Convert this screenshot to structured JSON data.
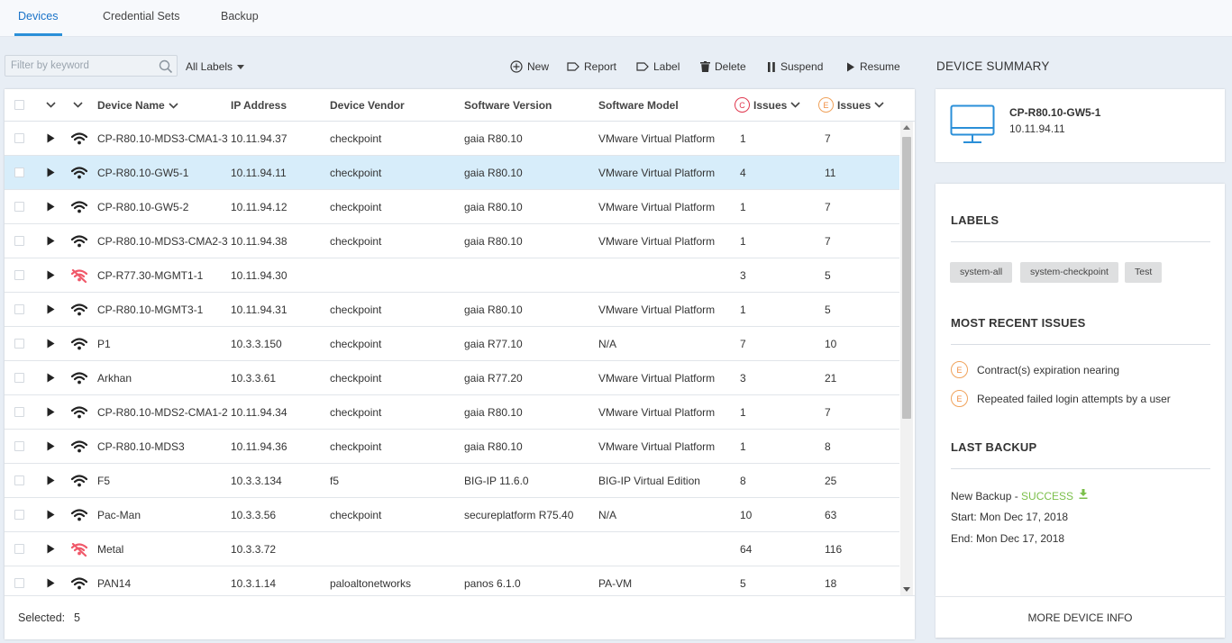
{
  "tabs": [
    {
      "label": "Devices",
      "active": true
    },
    {
      "label": "Credential Sets",
      "active": false
    },
    {
      "label": "Backup",
      "active": false
    }
  ],
  "toolbar": {
    "filter_placeholder": "Filter by keyword",
    "labels_dropdown": "All Labels",
    "new": "New",
    "report": "Report",
    "label": "Label",
    "delete": "Delete",
    "suspend": "Suspend",
    "resume": "Resume"
  },
  "table": {
    "headers": {
      "name": "Device Name",
      "ip": "IP Address",
      "vendor": "Device Vendor",
      "software": "Software Version",
      "model": "Software Model",
      "issues_c": "Issues",
      "issues_e": "Issues"
    },
    "issue_badges": {
      "critical": "C",
      "error": "E"
    },
    "rows": [
      {
        "name": "CP-R80.10-MDS3-CMA1-3",
        "ip": "10.11.94.37",
        "vendor": "checkpoint",
        "software": "gaia R80.10",
        "model": "VMware Virtual Platform",
        "issues_c": "1",
        "issues_e": "7",
        "online": true,
        "selected": false
      },
      {
        "name": "CP-R80.10-GW5-1",
        "ip": "10.11.94.11",
        "vendor": "checkpoint",
        "software": "gaia R80.10",
        "model": "VMware Virtual Platform",
        "issues_c": "4",
        "issues_e": "11",
        "online": true,
        "selected": true
      },
      {
        "name": "CP-R80.10-GW5-2",
        "ip": "10.11.94.12",
        "vendor": "checkpoint",
        "software": "gaia R80.10",
        "model": "VMware Virtual Platform",
        "issues_c": "1",
        "issues_e": "7",
        "online": true,
        "selected": false
      },
      {
        "name": "CP-R80.10-MDS3-CMA2-3",
        "ip": "10.11.94.38",
        "vendor": "checkpoint",
        "software": "gaia R80.10",
        "model": "VMware Virtual Platform",
        "issues_c": "1",
        "issues_e": "7",
        "online": true,
        "selected": false
      },
      {
        "name": "CP-R77.30-MGMT1-1",
        "ip": "10.11.94.30",
        "vendor": "",
        "software": "",
        "model": "",
        "issues_c": "3",
        "issues_e": "5",
        "online": false,
        "selected": false
      },
      {
        "name": "CP-R80.10-MGMT3-1",
        "ip": "10.11.94.31",
        "vendor": "checkpoint",
        "software": "gaia R80.10",
        "model": "VMware Virtual Platform",
        "issues_c": "1",
        "issues_e": "5",
        "online": true,
        "selected": false
      },
      {
        "name": "P1",
        "ip": "10.3.3.150",
        "vendor": "checkpoint",
        "software": "gaia R77.10",
        "model": "N/A",
        "issues_c": "7",
        "issues_e": "10",
        "online": true,
        "selected": false
      },
      {
        "name": "Arkhan",
        "ip": "10.3.3.61",
        "vendor": "checkpoint",
        "software": "gaia R77.20",
        "model": "VMware Virtual Platform",
        "issues_c": "3",
        "issues_e": "21",
        "online": true,
        "selected": false
      },
      {
        "name": "CP-R80.10-MDS2-CMA1-2",
        "ip": "10.11.94.34",
        "vendor": "checkpoint",
        "software": "gaia R80.10",
        "model": "VMware Virtual Platform",
        "issues_c": "1",
        "issues_e": "7",
        "online": true,
        "selected": false
      },
      {
        "name": "CP-R80.10-MDS3",
        "ip": "10.11.94.36",
        "vendor": "checkpoint",
        "software": "gaia R80.10",
        "model": "VMware Virtual Platform",
        "issues_c": "1",
        "issues_e": "8",
        "online": true,
        "selected": false
      },
      {
        "name": "F5",
        "ip": "10.3.3.134",
        "vendor": "f5",
        "software": "BIG-IP 11.6.0",
        "model": "BIG-IP Virtual Edition",
        "issues_c": "8",
        "issues_e": "25",
        "online": true,
        "selected": false
      },
      {
        "name": "Pac-Man",
        "ip": "10.3.3.56",
        "vendor": "checkpoint",
        "software": "secureplatform R75.40",
        "model": "N/A",
        "issues_c": "10",
        "issues_e": "63",
        "online": true,
        "selected": false
      },
      {
        "name": "Metal",
        "ip": "10.3.3.72",
        "vendor": "",
        "software": "",
        "model": "",
        "issues_c": "64",
        "issues_e": "116",
        "online": false,
        "selected": false
      },
      {
        "name": "PAN14",
        "ip": "10.3.1.14",
        "vendor": "paloaltonetworks",
        "software": "panos 6.1.0",
        "model": "PA-VM",
        "issues_c": "5",
        "issues_e": "18",
        "online": true,
        "selected": false
      }
    ]
  },
  "footer": {
    "selected_label": "Selected:",
    "selected_count": "5"
  },
  "summary": {
    "title": "DEVICE SUMMARY",
    "device_name": "CP-R80.10-GW5-1",
    "device_ip": "10.11.94.11",
    "labels_title": "LABELS",
    "labels": [
      "system-all",
      "system-checkpoint",
      "Test"
    ],
    "issues_title": "MOST RECENT ISSUES",
    "issue_badge": "E",
    "issues": [
      "Contract(s) expiration nearing",
      "Repeated failed login attempts by a user"
    ],
    "backup_title": "LAST BACKUP",
    "backup_label": "New Backup -",
    "backup_status": "SUCCESS",
    "backup_start": "Start: Mon Dec 17, 2018",
    "backup_end": "End: Mon Dec 17, 2018",
    "more_info": "MORE DEVICE INFO"
  },
  "colors": {
    "accent": "#2a8fd8",
    "selected_row": "#d7edfa",
    "critical": "#e0384f",
    "error": "#f08a3b",
    "success": "#7bbf4a",
    "offline_icon": "#f0596a"
  }
}
